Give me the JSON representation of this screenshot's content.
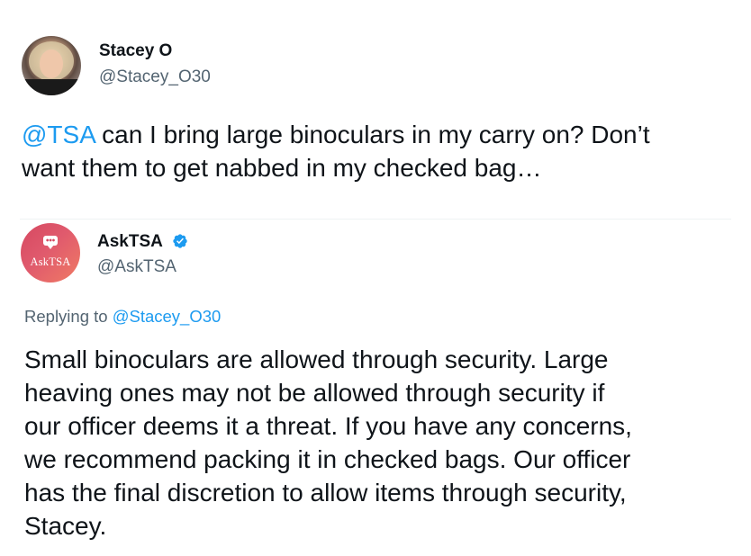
{
  "tweet_1": {
    "display_name": "Stacey O",
    "handle": "@Stacey_O30",
    "mention": "@TSA",
    "text_line_1": " can I bring large binoculars in my carry on? Don’t",
    "text_line_2": "want them to get nabbed in my checked bag…"
  },
  "tweet_2": {
    "display_name": "AskTSA",
    "handle": "@AskTSA",
    "verified": true,
    "avatar_logo_text": "AskTSA",
    "replying_prefix": "Replying to ",
    "replying_handle": "@Stacey_O30",
    "text_lines": [
      "Small binoculars are allowed through security. Large",
      "heaving ones may not be allowed through security if",
      "our officer deems it a threat. If you have any concerns,",
      "we recommend packing it in checked bags. Our officer",
      "has the final discretion to allow items through security,",
      "Stacey."
    ]
  },
  "colors": {
    "link_blue": "#1d9bf0",
    "secondary_text": "#536471",
    "primary_text": "#0f1419",
    "avatar_brand": "#d64861"
  },
  "icons": {
    "verified": "verified-badge-icon",
    "avatar_logo": "chat-bubble-icon"
  }
}
